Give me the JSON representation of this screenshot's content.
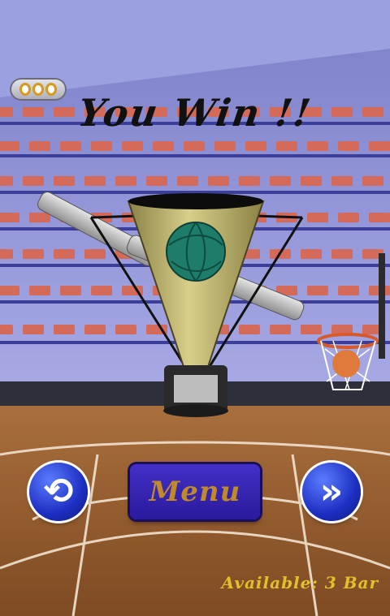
{
  "screen": {
    "title": "You Win !!",
    "hud": {
      "icon": "rings-counter-icon"
    },
    "buttons": {
      "replay": {
        "icon": "replay-icon",
        "glyph": "⟲"
      },
      "menu": {
        "label": "Menu"
      },
      "next": {
        "icon": "fast-forward-icon",
        "glyph": "»"
      }
    },
    "status": "Available: 3 Bar"
  },
  "colors": {
    "accent_blue": "#2435c8",
    "menu_text": "#c08a2a",
    "status_text": "#e1c02a",
    "trophy_gold": "#b3a85b"
  }
}
